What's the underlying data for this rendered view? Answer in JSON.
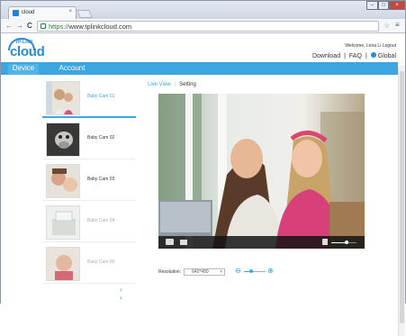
{
  "browser": {
    "tab_title": "cloud",
    "tab_close": "×",
    "url_scheme": "https://",
    "url_rest": "www.tplinkcloud.com",
    "back": "←",
    "forward": "→",
    "reload": "C",
    "star": "☆",
    "menu": "≡",
    "window_min": "–",
    "window_max": "□",
    "window_close": "×"
  },
  "header": {
    "logo_brand": "TP-LINK",
    "logo_product": "cloud",
    "welcome": "Welcome, Lena Li   Logout",
    "links": [
      "Download",
      "|",
      "FAQ",
      "|",
      "Global"
    ]
  },
  "nav": {
    "device": "Device",
    "account": "Account"
  },
  "cameras": [
    {
      "name": "Baby Cam 01",
      "state": "active"
    },
    {
      "name": "Baby Cam 02",
      "state": "online"
    },
    {
      "name": "Baby Cam 03",
      "state": "online"
    },
    {
      "name": "Baby Cam 04",
      "state": "offline"
    },
    {
      "name": "Baby Cam 05",
      "state": "offline"
    }
  ],
  "pager": "‹ ›",
  "view_tabs": {
    "live": "Live View",
    "sep": "|",
    "setting": "Setting"
  },
  "player": {
    "volume": 0.6,
    "resolution_label": "Resolution:",
    "resolution_value": "640*480",
    "zoom_out": "⊖",
    "zoom_in": "⊕",
    "zoom_level": 0.35
  },
  "colors": {
    "accent": "#3da5df",
    "nav_bg": "#3da5df"
  }
}
